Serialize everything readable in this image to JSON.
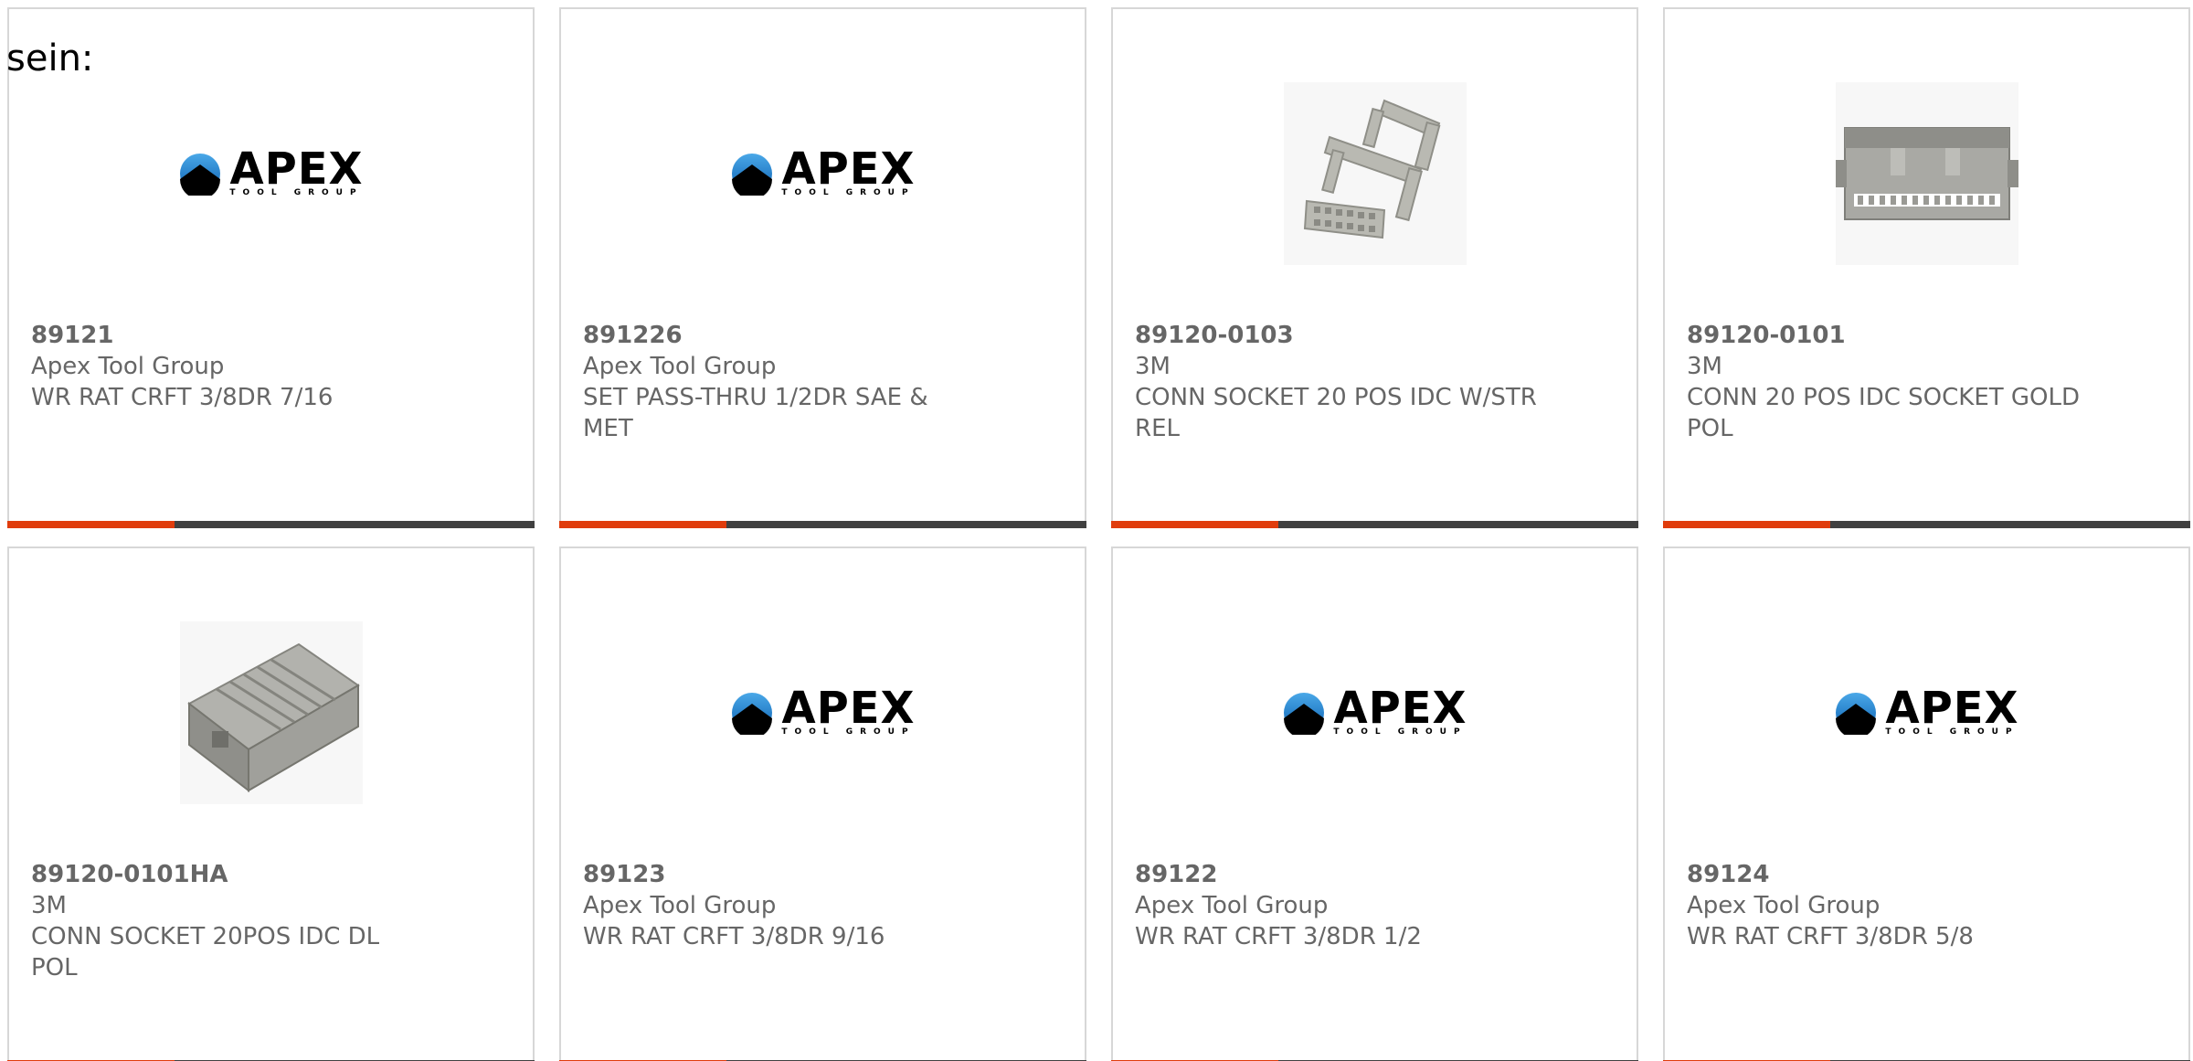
{
  "intro_text": "sein:",
  "colors": {
    "accent_red": "#e03c0c",
    "accent_dark": "#404040",
    "text_gray": "#666666",
    "card_border": "#d7d7d7"
  },
  "logo": {
    "brand": "APEX",
    "tagline": "TOOL GROUP"
  },
  "products": [
    {
      "part_number": "89121",
      "manufacturer": "Apex Tool Group",
      "description": "WR RAT CRFT 3/8DR 7/16",
      "image": "apex-logo"
    },
    {
      "part_number": "891226",
      "manufacturer": "Apex Tool Group",
      "description": "SET PASS-THRU 1/2DR SAE & MET",
      "image": "apex-logo"
    },
    {
      "part_number": "89120-0103",
      "manufacturer": "3M",
      "description": "CONN SOCKET 20 POS IDC W/STR REL",
      "image": "idc-socket-strain-relief-photo"
    },
    {
      "part_number": "89120-0101",
      "manufacturer": "3M",
      "description": "CONN 20 POS IDC SOCKET GOLD POL",
      "image": "idc-socket-photo"
    },
    {
      "part_number": "89120-0101HA",
      "manufacturer": "3M",
      "description": "CONN SOCKET 20POS IDC DL POL",
      "image": "idc-socket-angled-photo"
    },
    {
      "part_number": "89123",
      "manufacturer": "Apex Tool Group",
      "description": "WR RAT CRFT 3/8DR 9/16",
      "image": "apex-logo"
    },
    {
      "part_number": "89122",
      "manufacturer": "Apex Tool Group",
      "description": "WR RAT CRFT 3/8DR 1/2",
      "image": "apex-logo"
    },
    {
      "part_number": "89124",
      "manufacturer": "Apex Tool Group",
      "description": "WR RAT CRFT 3/8DR 5/8",
      "image": "apex-logo"
    }
  ]
}
